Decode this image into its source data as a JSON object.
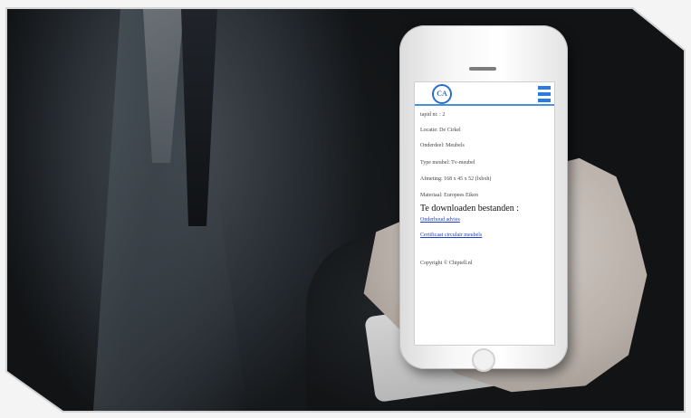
{
  "phone_screen": {
    "logo_text": "CA",
    "lines": [
      "tapid nr. : 2",
      "Locatie: De Cirkel",
      "Onderdeel: Meubels",
      "Type meubel: Tv-meubel",
      "Afmeting: 168 x 45 x 52 (lxbxh)",
      "Materiaal: Europees Eiken"
    ],
    "downloads_heading": "Te downloaden bestanden :",
    "links": [
      "Onderhoud advies",
      "Certificaat circulair meubels"
    ],
    "copyright": "Copyright © Chiptell.nl"
  },
  "colors": {
    "accent_blue": "#2a7be0",
    "link_blue": "#1c40c8",
    "suit_dark": "#111315"
  },
  "icons": [
    "hamburger-menu-icon",
    "logo-icon"
  ]
}
